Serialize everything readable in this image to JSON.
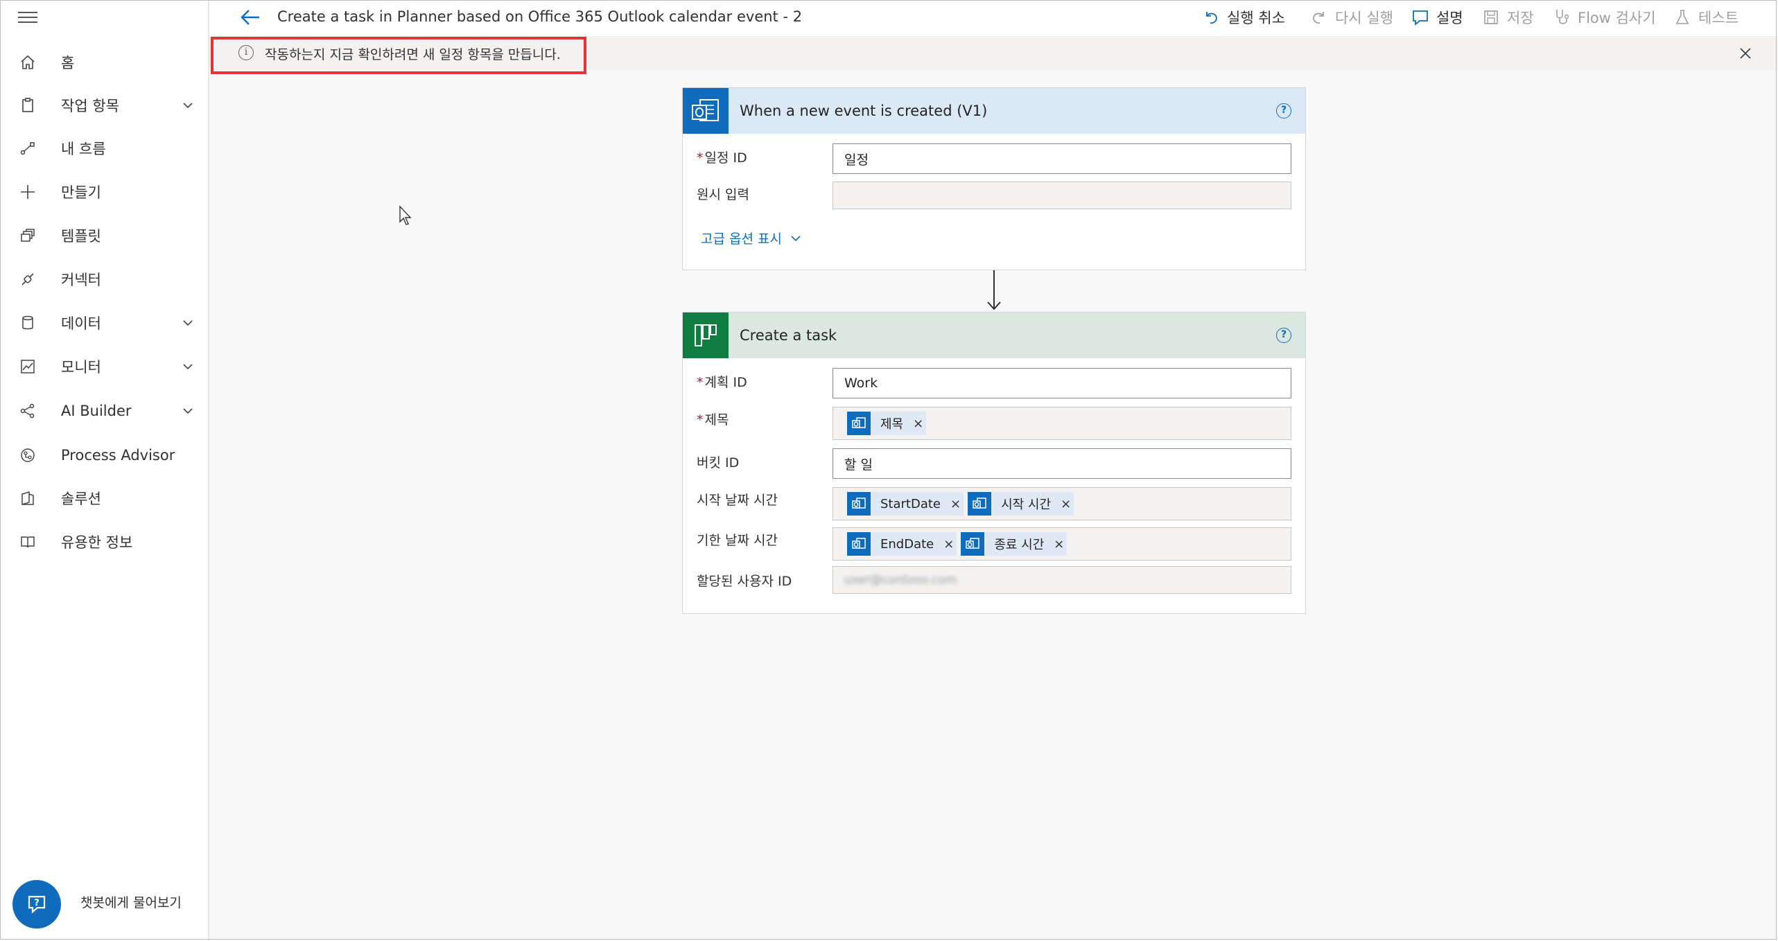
{
  "sidebar": {
    "items": [
      {
        "label": "홈",
        "icon": "home-icon",
        "chevron": false
      },
      {
        "label": "작업 항목",
        "icon": "clipboard-icon",
        "chevron": true
      },
      {
        "label": "내 흐름",
        "icon": "flow-icon",
        "chevron": false
      },
      {
        "label": "만들기",
        "icon": "plus-icon",
        "chevron": false
      },
      {
        "label": "템플릿",
        "icon": "template-icon",
        "chevron": false
      },
      {
        "label": "커넥터",
        "icon": "connector-icon",
        "chevron": false
      },
      {
        "label": "데이터",
        "icon": "database-icon",
        "chevron": true
      },
      {
        "label": "모니터",
        "icon": "monitor-icon",
        "chevron": true
      },
      {
        "label": "AI Builder",
        "icon": "ai-builder-icon",
        "chevron": true
      },
      {
        "label": "Process Advisor",
        "icon": "process-advisor-icon",
        "chevron": false
      },
      {
        "label": "솔루션",
        "icon": "solution-icon",
        "chevron": false
      },
      {
        "label": "유용한 정보",
        "icon": "book-icon",
        "chevron": false
      }
    ],
    "chatbot_label": "챗봇에게 물어보기"
  },
  "topbar": {
    "title": "Create a task in Planner based on Office 365 Outlook calendar event - 2",
    "undo": "실행 취소",
    "redo": "다시 실행",
    "comment": "설명",
    "save": "저장",
    "flow_checker": "Flow 검사기",
    "test": "테스트"
  },
  "infobar": {
    "message": "작동하는지 지금 확인하려면 새 일정 항목을 만듭니다."
  },
  "trigger_card": {
    "title": "When a new event is created (V1)",
    "header_color": "#dbe8f6",
    "fields": {
      "calendar_id_label": "일정 ID",
      "calendar_id_value": "일정",
      "raw_input_label": "원시 입력",
      "raw_input_value": ""
    },
    "advanced_link": "고급 옵션 표시"
  },
  "action_card": {
    "title": "Create a task",
    "header_color": "#dae8e1",
    "fields": {
      "plan_id_label": "계획 ID",
      "plan_id_value": "Work",
      "title_label": "제목",
      "title_token": "제목",
      "bucket_id_label": "버킷 ID",
      "bucket_id_value": "할 일",
      "start_label": "시작 날짜 시간",
      "start_token_1": "StartDate",
      "start_token_2": "시작 시간",
      "due_label": "기한 날짜 시간",
      "due_token_1": "EndDate",
      "due_token_2": "종료 시간",
      "assigned_label": "할당된 사용자 ID",
      "assigned_value": "user@contoso.com"
    }
  },
  "colors": {
    "accent": "#0f6cbd",
    "planner_green": "#107c41",
    "highlight_red": "#e0363a"
  }
}
